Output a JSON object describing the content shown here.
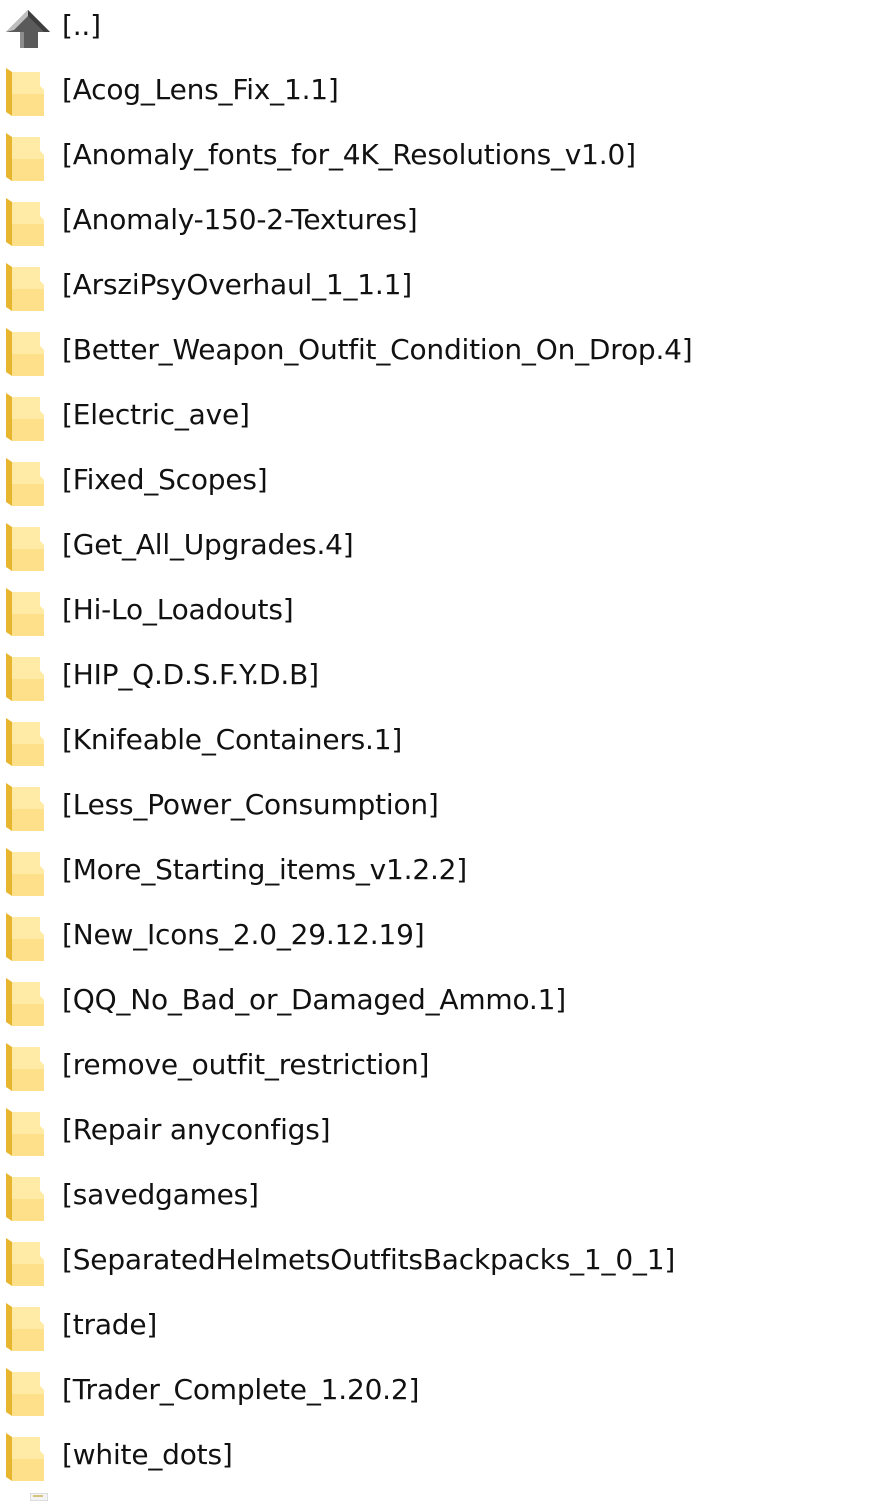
{
  "colors": {
    "folder_back": "#E8B52E",
    "folder_front": "#FFE08A",
    "folder_front_light": "#FFEBA6",
    "up_arrow_dark": "#5A5A5A",
    "up_arrow_light": "#BFBFBF",
    "text": "#111111",
    "background": "#FFFFFF"
  },
  "parent": {
    "label": "[..]",
    "icon": "up-arrow-icon"
  },
  "folders": [
    {
      "label": "[Acog_Lens_Fix_1.1]",
      "icon": "folder-icon"
    },
    {
      "label": "[Anomaly_fonts_for_4K_Resolutions_v1.0]",
      "icon": "folder-icon"
    },
    {
      "label": "[Anomaly-150-2-Textures]",
      "icon": "folder-icon"
    },
    {
      "label": "[ArsziPsyOverhaul_1_1.1]",
      "icon": "folder-icon"
    },
    {
      "label": "[Better_Weapon_Outfit_Condition_On_Drop.4]",
      "icon": "folder-icon"
    },
    {
      "label": "[Electric_ave]",
      "icon": "folder-icon"
    },
    {
      "label": "[Fixed_Scopes]",
      "icon": "folder-icon"
    },
    {
      "label": "[Get_All_Upgrades.4]",
      "icon": "folder-icon"
    },
    {
      "label": "[Hi-Lo_Loadouts]",
      "icon": "folder-icon"
    },
    {
      "label": "[HIP_Q.D.S.F.Y.D.B]",
      "icon": "folder-icon"
    },
    {
      "label": "[Knifeable_Containers.1]",
      "icon": "folder-icon"
    },
    {
      "label": "[Less_Power_Consumption]",
      "icon": "folder-icon"
    },
    {
      "label": "[More_Starting_items_v1.2.2]",
      "icon": "folder-icon"
    },
    {
      "label": "[New_Icons_2.0_29.12.19]",
      "icon": "folder-icon"
    },
    {
      "label": "[QQ_No_Bad_or_Damaged_Ammo.1]",
      "icon": "folder-icon"
    },
    {
      "label": "[remove_outfit_restriction]",
      "icon": "folder-icon"
    },
    {
      "label": "[Repair anyconfigs]",
      "icon": "folder-icon"
    },
    {
      "label": "[savedgames]",
      "icon": "folder-icon"
    },
    {
      "label": "[SeparatedHelmetsOutfitsBackpacks_1_0_1]",
      "icon": "folder-icon"
    },
    {
      "label": "[trade]",
      "icon": "folder-icon"
    },
    {
      "label": "[Trader_Complete_1.20.2]",
      "icon": "folder-icon"
    },
    {
      "label": "[white_dots]",
      "icon": "folder-icon"
    }
  ]
}
